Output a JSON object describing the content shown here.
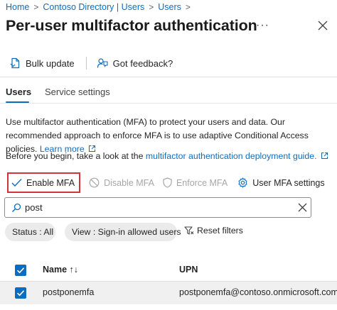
{
  "breadcrumb": [
    "Home",
    "Contoso Directory | Users",
    "Users"
  ],
  "page_title": "Per-user multifactor authentication",
  "more_label": "···",
  "toolbar": {
    "bulk_update": "Bulk update",
    "feedback": "Got feedback?"
  },
  "tabs": [
    {
      "label": "Users",
      "selected": true
    },
    {
      "label": "Service settings",
      "selected": false
    }
  ],
  "description": {
    "text": "Use multifactor authentication (MFA) to protect your users and data. Our recommended approach to enforce MFA is to use adaptive Conditional Access policies. ",
    "link": "Learn more"
  },
  "before_begin": {
    "text": "Before you begin, take a look at the ",
    "link": "multifactor authentication deployment guide."
  },
  "actions": {
    "enable": "Enable MFA",
    "disable": "Disable MFA",
    "enforce": "Enforce MFA",
    "settings": "User MFA settings"
  },
  "search": {
    "value": "post"
  },
  "filters": {
    "status": "Status : All",
    "view": "View : Sign-in allowed users",
    "reset": "Reset filters"
  },
  "table": {
    "columns": [
      "Name ↑↓",
      "UPN"
    ],
    "rows": [
      {
        "name": "postponemfa",
        "upn": "postponemfa@contoso.onmicrosoft.com",
        "selected": true
      }
    ],
    "all_selected": true
  },
  "colors": {
    "accent": "#0f6cbd",
    "highlight_border": "#d13438",
    "disabled_text": "#a6a6a6"
  }
}
